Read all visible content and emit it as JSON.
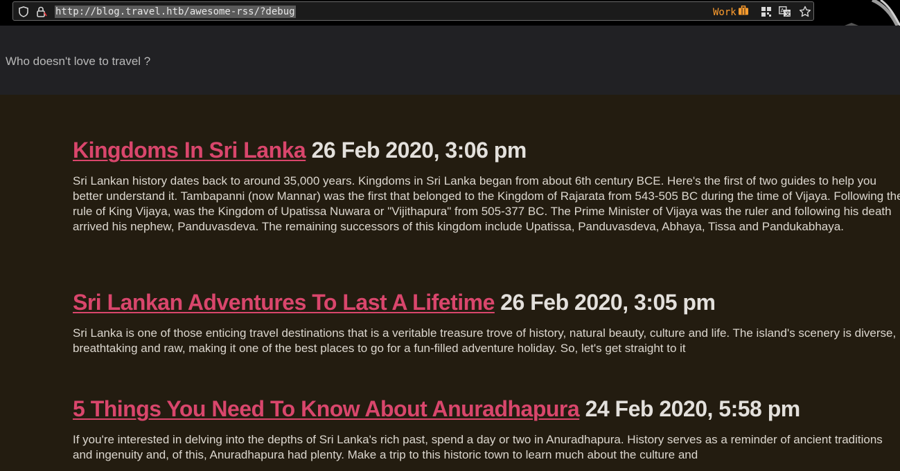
{
  "browser": {
    "url": "http://blog.travel.htb/awesome-rss/?debug",
    "container_label": "Work",
    "colors": {
      "container": "#ff9d2e",
      "link": "#d9466c"
    }
  },
  "site": {
    "tagline": "Who doesn't love to travel ?"
  },
  "posts": [
    {
      "title": "Kingdoms In Sri Lanka",
      "date": "26 Feb 2020, 3:06 pm",
      "excerpt": "Sri Lankan history dates back to around 35,000 years. Kingdoms in Sri Lanka began from about 6th century BCE. Here's the first of two guides to help you better understand it. Tambapanni (now Mannar) was the first that belonged to the Kingdom of Rajarata from 543-505 BC during the time of Vijaya. Following the rule of King Vijaya, was the Kingdom of Upatissa Nuwara or \"Vijithapura\" from 505-377 BC. The Prime Minister of Vijaya was the ruler and following his death arrived his nephew, Panduvasdeva. The remaining successors of this kingdom include Upatissa, Panduvasdeva, Abhaya, Tissa and Pandukabhaya."
    },
    {
      "title": "Sri Lankan Adventures To Last A Lifetime",
      "date": "26 Feb 2020, 3:05 pm",
      "excerpt": "Sri Lanka is one of those enticing travel destinations that is a veritable treasure trove of history, natural beauty, culture and life. The island's scenery is diverse, breathtaking and raw, making it one of the best places to go for a fun-filled adventure holiday. So, let's get straight to it"
    },
    {
      "title": "5 Things You Need To Know About Anuradhapura",
      "date": "24 Feb 2020, 5:58 pm",
      "excerpt": "If you're interested in delving into the depths of Sri Lanka's rich past, spend a day or two in Anuradhapura. History serves as a reminder of ancient traditions and ingenuity and, of this, Anuradhapura had plenty. Make a trip to this historic town to learn much about the culture and"
    }
  ]
}
